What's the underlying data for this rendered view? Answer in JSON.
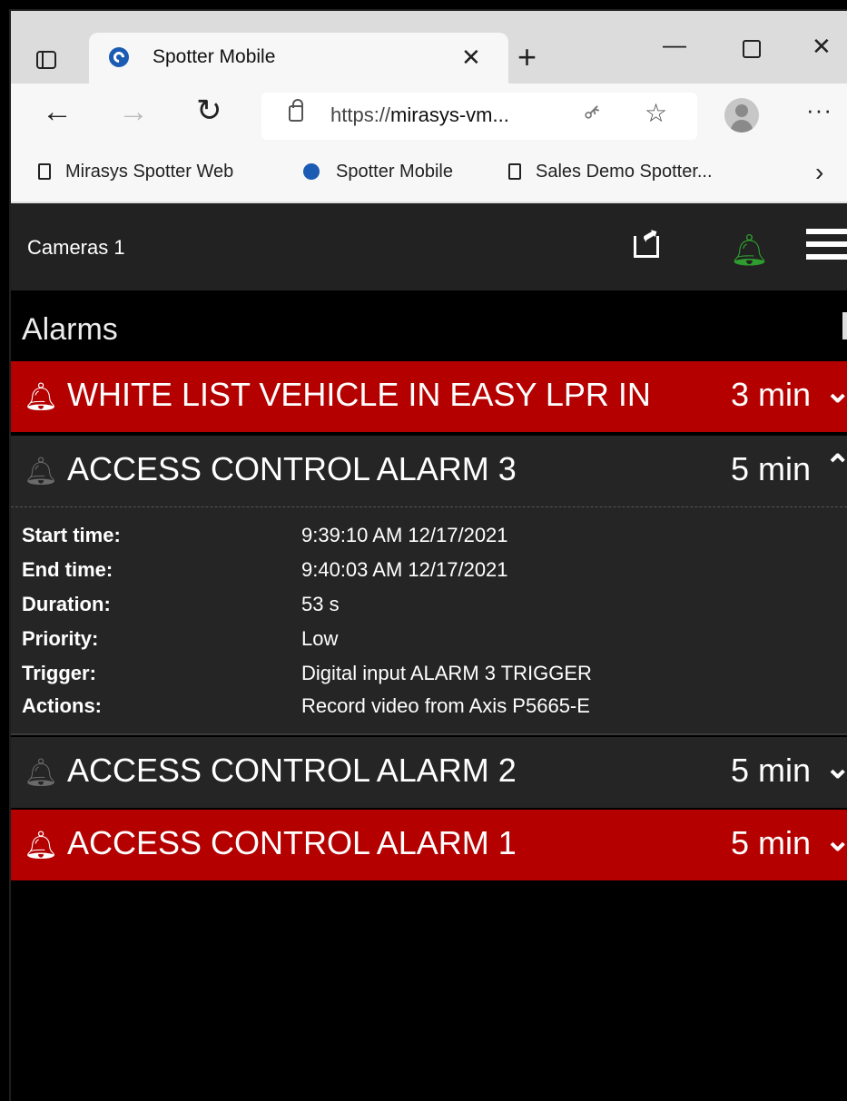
{
  "browser": {
    "tab_title": "Spotter Mobile",
    "tab_close": "✕",
    "new_tab": "+",
    "url_prefix": "https://",
    "url_host": "mirasys-vm...",
    "bookmarks": [
      "Mirasys Spotter Web",
      "Spotter Mobile",
      "Sales Demo Spotter..."
    ],
    "more_menu": "···"
  },
  "app": {
    "title": "Cameras 1",
    "bell_color": "#2e9d2e",
    "alarm_red": "#b50000"
  },
  "alarms": {
    "heading": "Alarms",
    "items": [
      {
        "name": "WHITE LIST VEHICLE IN EASY LPR IN",
        "time": "3 min",
        "state": "active",
        "expanded": false
      },
      {
        "name": "ACCESS CONTROL ALARM 3",
        "time": "5 min",
        "state": "inactive",
        "expanded": true
      },
      {
        "name": "ACCESS CONTROL ALARM 2",
        "time": "5 min",
        "state": "inactive",
        "expanded": false
      },
      {
        "name": "ACCESS CONTROL ALARM 1",
        "time": "5 min",
        "state": "active",
        "expanded": false
      }
    ],
    "details": [
      {
        "key": "Start time:",
        "value": "9:39:10 AM 12/17/2021"
      },
      {
        "key": "End time:",
        "value": "9:40:03 AM 12/17/2021"
      },
      {
        "key": "Duration:",
        "value": "53 s"
      },
      {
        "key": "Priority:",
        "value": "Low"
      },
      {
        "key": "Trigger:",
        "value": "Digital input ALARM 3 TRIGGER"
      },
      {
        "key": "Actions:",
        "value": "Record video from Axis P5665-E"
      }
    ]
  }
}
